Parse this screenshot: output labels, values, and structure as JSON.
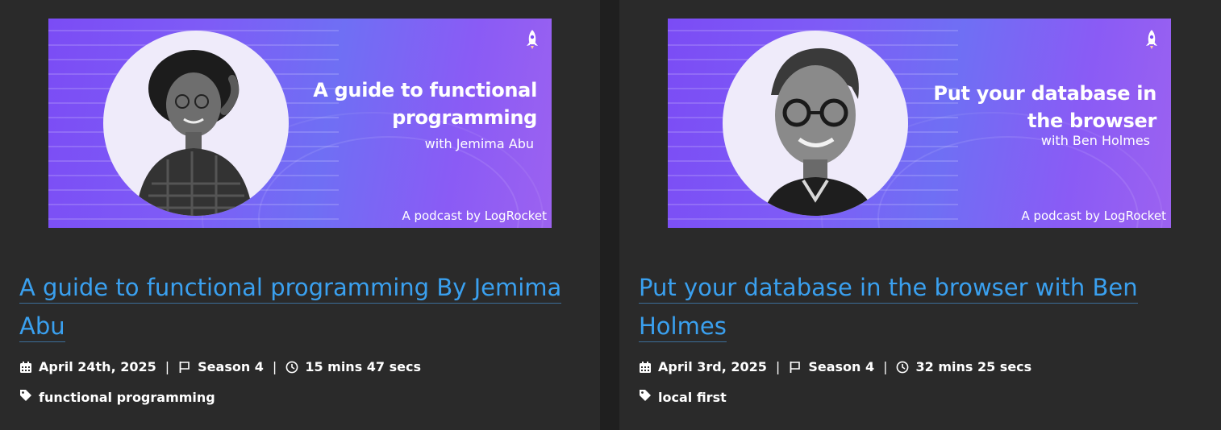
{
  "episodes": [
    {
      "banner": {
        "title_line1": "A guide to functional",
        "title_line2": "programming",
        "subtitle": "with Jemima Abu",
        "footer": "A podcast by LogRocket"
      },
      "title": "A guide to functional programming By Jemima Abu",
      "date": "April 24th, 2025",
      "season": "Season 4",
      "duration": "15 mins 47 secs",
      "tag": "functional programming"
    },
    {
      "banner": {
        "title_line1": "Put your database in",
        "title_line2": "the browser",
        "subtitle": "with Ben Holmes",
        "footer": "A podcast by LogRocket"
      },
      "title": "Put your database in the browser with Ben Holmes",
      "date": "April 3rd, 2025",
      "season": "Season 4",
      "duration": "32 mins 25 secs",
      "tag": "local first"
    }
  ],
  "separator": "|",
  "icons": {
    "date": "calendar-icon",
    "season": "flag-icon",
    "duration": "clock-icon",
    "tag": "tag-icon",
    "brand": "rocket-icon"
  },
  "colors": {
    "link": "#3aa0ef",
    "card_bg": "#2a2a2a",
    "banner_purple": "#7b4cf5"
  }
}
